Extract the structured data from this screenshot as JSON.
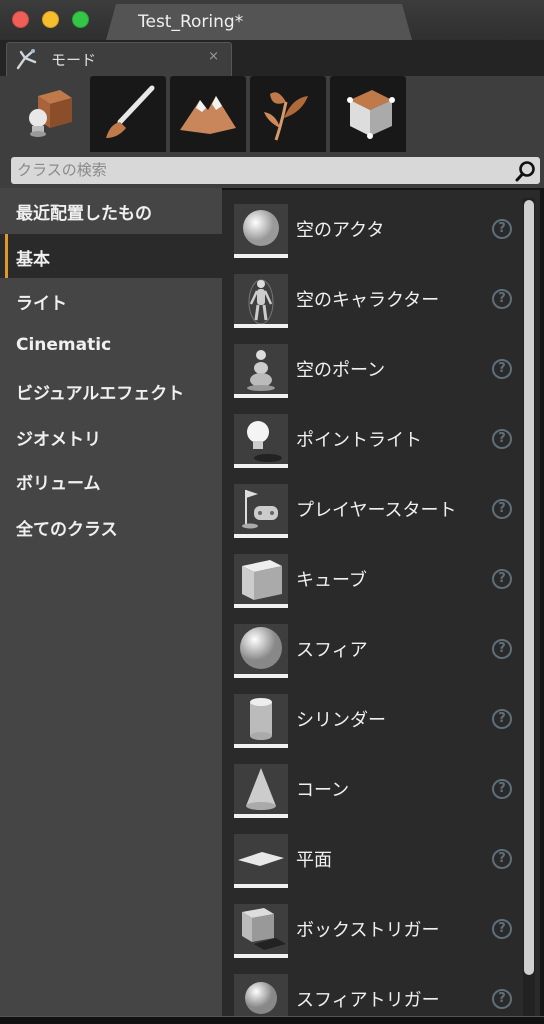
{
  "window": {
    "document_title": "Test_Roring*"
  },
  "mode_tab": {
    "label": "モード",
    "icon": "modes-icon",
    "close_glyph": "×"
  },
  "toolbar": {
    "tools": [
      {
        "name": "place",
        "icon": "place-mode-icon",
        "active": true
      },
      {
        "name": "paint",
        "icon": "paint-brush-icon",
        "active": false
      },
      {
        "name": "landscape",
        "icon": "landscape-icon",
        "active": false
      },
      {
        "name": "foliage",
        "icon": "foliage-icon",
        "active": false
      },
      {
        "name": "geometry",
        "icon": "geometry-edit-icon",
        "active": false
      }
    ]
  },
  "search": {
    "placeholder": "クラスの検索",
    "value": ""
  },
  "categories": [
    {
      "label": "最近配置したもの",
      "selected": false
    },
    {
      "label": "基本",
      "selected": true
    },
    {
      "label": "ライト",
      "selected": false
    },
    {
      "label": "Cinematic",
      "selected": false
    },
    {
      "label": "ビジュアルエフェクト",
      "selected": false
    },
    {
      "label": "ジオメトリ",
      "selected": false
    },
    {
      "label": "ボリューム",
      "selected": false
    },
    {
      "label": "全てのクラス",
      "selected": false
    }
  ],
  "items": [
    {
      "label": "空のアクタ",
      "icon": "empty-actor-icon",
      "help": "?"
    },
    {
      "label": "空のキャラクター",
      "icon": "empty-character-icon",
      "help": "?"
    },
    {
      "label": "空のポーン",
      "icon": "empty-pawn-icon",
      "help": "?"
    },
    {
      "label": "ポイントライト",
      "icon": "point-light-icon",
      "help": "?"
    },
    {
      "label": "プレイヤースタート",
      "icon": "player-start-icon",
      "help": "?"
    },
    {
      "label": "キューブ",
      "icon": "cube-icon",
      "help": "?"
    },
    {
      "label": "スフィア",
      "icon": "sphere-icon",
      "help": "?"
    },
    {
      "label": "シリンダー",
      "icon": "cylinder-icon",
      "help": "?"
    },
    {
      "label": "コーン",
      "icon": "cone-icon",
      "help": "?"
    },
    {
      "label": "平面",
      "icon": "plane-icon",
      "help": "?"
    },
    {
      "label": "ボックストリガー",
      "icon": "box-trigger-icon",
      "help": "?"
    },
    {
      "label": "スフィアトリガー",
      "icon": "sphere-trigger-icon",
      "help": "?"
    }
  ],
  "colors": {
    "accent_selected": "#e09a2c",
    "help_icon": "#5f6f7a"
  }
}
